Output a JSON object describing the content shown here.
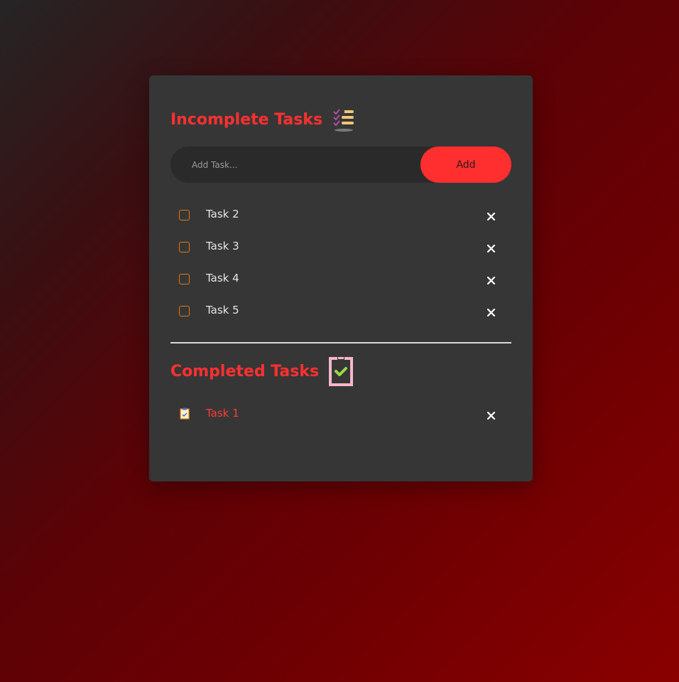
{
  "incomplete": {
    "title": "Incomplete Tasks",
    "icon": "checklist-icon",
    "add_placeholder": "Add Task...",
    "add_label": "Add",
    "tasks": [
      {
        "label": "Task 2",
        "checked": false
      },
      {
        "label": "Task 3",
        "checked": false
      },
      {
        "label": "Task 4",
        "checked": false
      },
      {
        "label": "Task 5",
        "checked": false
      }
    ]
  },
  "completed": {
    "title": "Completed Tasks",
    "icon": "clipboard-check-icon",
    "tasks": [
      {
        "label": "Task 1",
        "checked": true
      }
    ]
  },
  "colors": {
    "accent": "#ff2f2f",
    "checkbox_border": "#e07818",
    "card_bg": "#363636"
  }
}
